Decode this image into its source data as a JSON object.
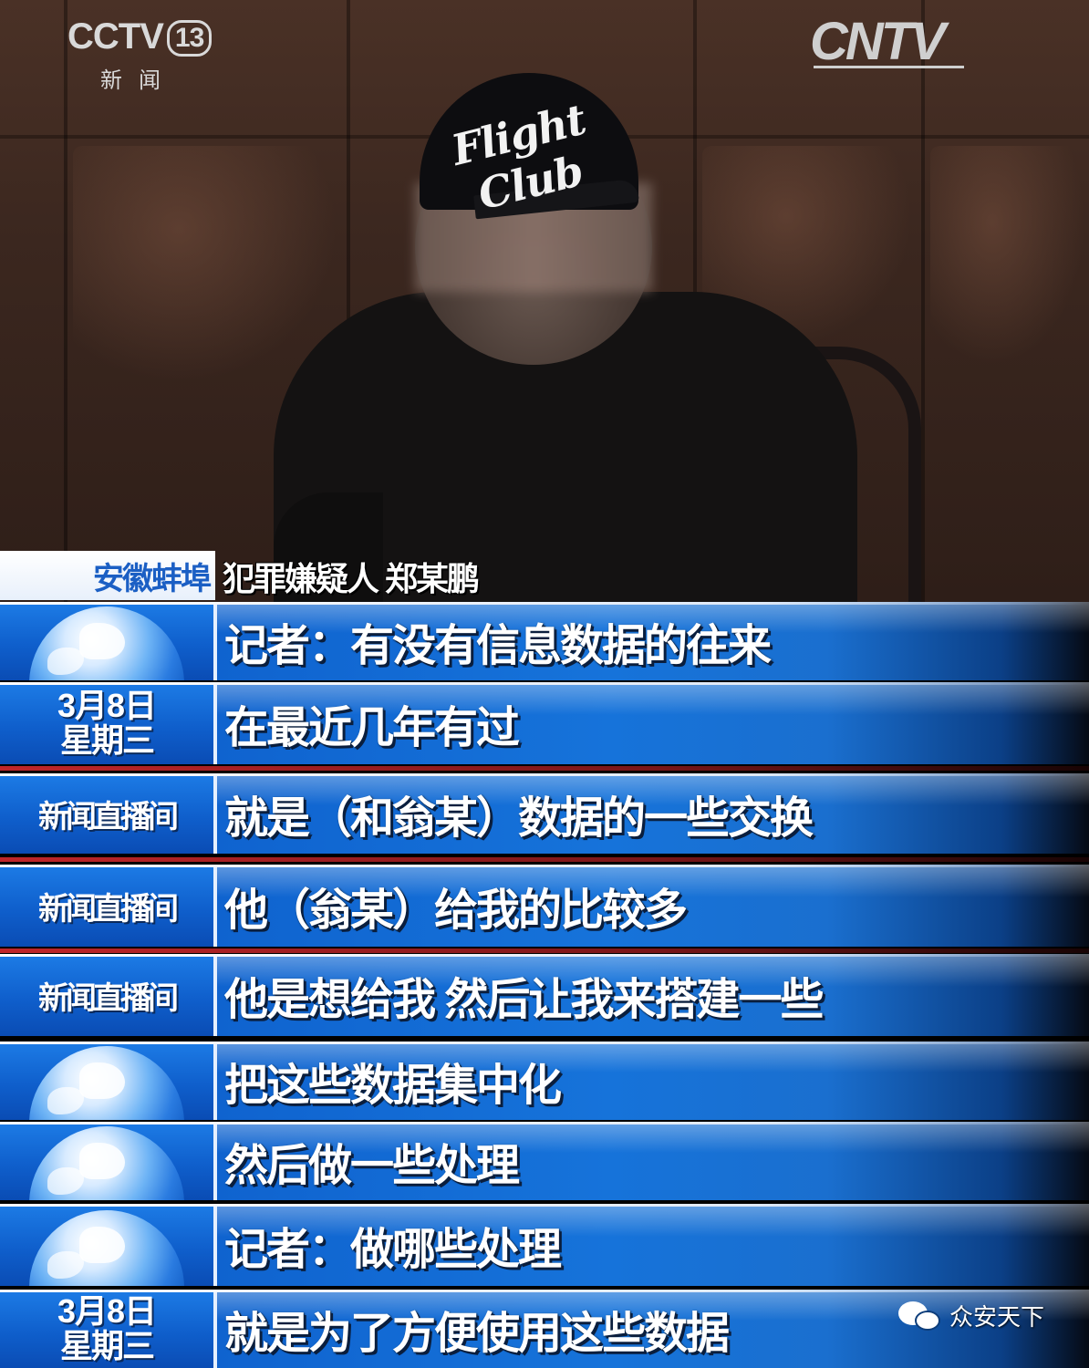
{
  "broadcast": {
    "channel_logo": "CCTV",
    "channel_number": "13",
    "channel_subtitle": "新闻",
    "network_logo": "CNTV",
    "cap_text": "Flight Club"
  },
  "lower_third": {
    "location": "安徽蚌埠",
    "person_label": "犯罪嫌疑人 郑某鹏"
  },
  "strips": [
    {
      "left_type": "globe",
      "left_icon": "globe-icon",
      "caption": "记者：有没有信息数据的往来"
    },
    {
      "left_type": "date",
      "date_line1": "3月8日",
      "date_line2": "星期三",
      "caption": "在最近几年有过"
    },
    {
      "left_type": "program",
      "program_label": "新闻直播间",
      "caption": "就是（和翁某）数据的一些交换"
    },
    {
      "left_type": "program",
      "program_label": "新闻直播间",
      "caption": "他（翁某）给我的比较多"
    },
    {
      "left_type": "program",
      "program_label": "新闻直播间",
      "caption": "他是想给我 然后让我来搭建一些"
    },
    {
      "left_type": "globe",
      "left_icon": "globe-icon",
      "caption": "把这些数据集中化"
    },
    {
      "left_type": "globe",
      "left_icon": "globe-icon",
      "caption": "然后做一些处理"
    },
    {
      "left_type": "globe",
      "left_icon": "globe-icon",
      "caption": "记者：做哪些处理"
    },
    {
      "left_type": "date",
      "date_line1": "3月8日",
      "date_line2": "星期三",
      "caption": "就是为了方便使用这些数据"
    }
  ],
  "watermark": {
    "icon": "wechat-icon",
    "text": "众安天下"
  },
  "colors": {
    "strip_blue": "#1673da",
    "location_text": "#1b5fc4",
    "separator_red": "#c0262a"
  }
}
